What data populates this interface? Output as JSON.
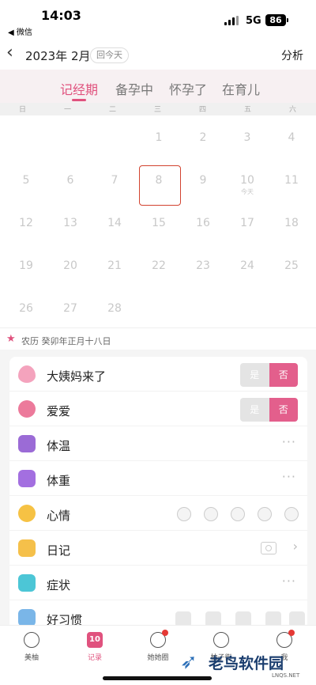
{
  "status_bar": {
    "time": "14:03",
    "back_app": "◀ 微信",
    "network": "5G",
    "battery": "86"
  },
  "header": {
    "title": "2023年 2月",
    "today_button": "回今天",
    "analysis": "分析"
  },
  "tabs": [
    {
      "label": "记经期",
      "active": true
    },
    {
      "label": "备孕中",
      "active": false
    },
    {
      "label": "怀孕了",
      "active": false
    },
    {
      "label": "在育儿",
      "active": false
    }
  ],
  "weekdays": [
    "日",
    "一",
    "二",
    "三",
    "四",
    "五",
    "六"
  ],
  "calendar": {
    "weeks": [
      [
        "",
        "",
        "",
        "1",
        "2",
        "3",
        "4"
      ],
      [
        "5",
        "6",
        "7",
        "8",
        "9",
        "10",
        "11"
      ],
      [
        "12",
        "13",
        "14",
        "15",
        "16",
        "17",
        "18"
      ],
      [
        "19",
        "20",
        "21",
        "22",
        "23",
        "24",
        "25"
      ],
      [
        "26",
        "27",
        "28",
        "",
        "",
        "",
        ""
      ]
    ],
    "selected_day": "8",
    "day10_sub": "今天"
  },
  "lunar": {
    "star": "★",
    "text": "农历 癸卯年正月十八日"
  },
  "records": {
    "period": {
      "label": "大姨妈来了",
      "yes": "是",
      "no": "否"
    },
    "love": {
      "label": "爱爱",
      "yes": "是",
      "no": "否"
    },
    "temperature": {
      "label": "体温"
    },
    "weight": {
      "label": "体重"
    },
    "mood": {
      "label": "心情"
    },
    "diary": {
      "label": "日记"
    },
    "symptom": {
      "label": "症状"
    },
    "habit": {
      "label": "好习惯"
    },
    "more_dots": "···",
    "chevron": "›"
  },
  "bottom_nav": [
    {
      "label": "美柚"
    },
    {
      "label": "记录",
      "icon_text": "10"
    },
    {
      "label": "她她圈"
    },
    {
      "label": "柚子街"
    },
    {
      "label": "我"
    }
  ],
  "colors": {
    "accent": "#e0527e",
    "selected_border": "#d2432f",
    "toggle_no": "#e35f8c"
  },
  "watermark": {
    "text": "老鸟软件园",
    "sub": "LNQS.NET"
  }
}
